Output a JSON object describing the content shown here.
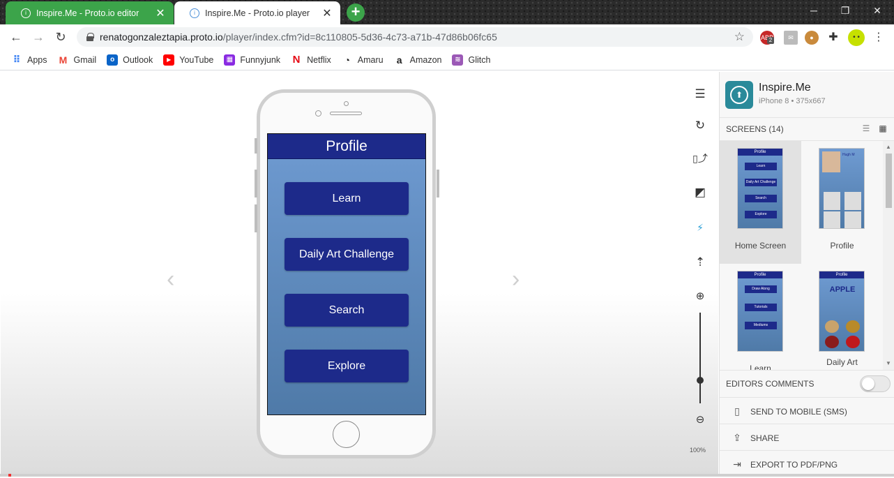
{
  "tabs": [
    {
      "label": "Inspire.Me - Proto.io editor",
      "close": "✕"
    },
    {
      "label": "Inspire.Me - Proto.io player",
      "close": "✕"
    }
  ],
  "new_tab": "+",
  "window_controls": {
    "minimize": "─",
    "restore": "❐",
    "close": "✕"
  },
  "address": {
    "domain": "renatogonzaleztapia.proto.io",
    "path": "/player/index.cfm?id=8c110805-5d36-4c73-a71b-47d86b06fc65"
  },
  "extensions": {
    "abp_badge": "2"
  },
  "bookmarks": [
    {
      "label": "Apps",
      "icon": "apps-grid-icon",
      "color": "#4285f4"
    },
    {
      "label": "Gmail",
      "icon": "gmail-icon",
      "color": "#ea4335"
    },
    {
      "label": "Outlook",
      "icon": "outlook-icon",
      "color": "#0a64c8"
    },
    {
      "label": "YouTube",
      "icon": "youtube-icon",
      "color": "#ff0000"
    },
    {
      "label": "Funnyjunk",
      "icon": "funnyjunk-icon",
      "color": "#8a2be2"
    },
    {
      "label": "Netflix",
      "icon": "netflix-icon",
      "color": "#e50914"
    },
    {
      "label": "Amaru",
      "icon": "amaru-icon",
      "color": "#222222"
    },
    {
      "label": "Amazon",
      "icon": "amazon-icon",
      "color": "#222222"
    },
    {
      "label": "Glitch",
      "icon": "glitch-icon",
      "color": "#9b59b6"
    }
  ],
  "phone_screen": {
    "title": "Profile",
    "buttons": [
      "Learn",
      "Daily Art Challenge",
      "Search",
      "Explore"
    ]
  },
  "nav_arrows": {
    "prev": "‹",
    "next": "›"
  },
  "zoom_level": "100%",
  "panel": {
    "app_name": "Inspire.Me",
    "device": "iPhone 8 • 375x667",
    "screens_header": "SCREENS (14)",
    "screens": [
      {
        "label": "Home Screen",
        "mini_title": "Profile",
        "mini_buttons": [
          "Learn",
          "Daily Art Challenge",
          "Search",
          "Explore"
        ]
      },
      {
        "label": "Profile",
        "mini_title": "Hugh M"
      },
      {
        "label": "Learn",
        "mini_title": "Profile",
        "mini_buttons": [
          "Draw Along",
          "Tutorials",
          "Mediums"
        ]
      },
      {
        "label": "Daily Art",
        "mini_title": "Profile",
        "mini_heading": "APPLE"
      }
    ],
    "editors_comments": "EDITORS COMMENTS",
    "send_to_mobile": "SEND TO MOBILE (SMS)",
    "share": "SHARE",
    "export": "EXPORT TO PDF/PNG"
  },
  "colors": {
    "accent_green": "#3ca44a",
    "app_navy": "#1d2a8a",
    "app_blue": "#6f9bd2",
    "app_icon_teal": "#2a8a9a"
  }
}
